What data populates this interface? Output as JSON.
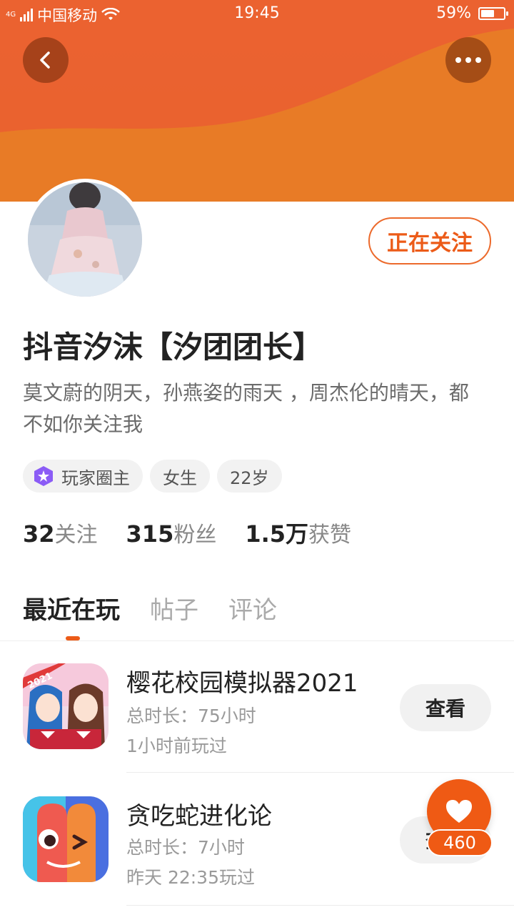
{
  "status_bar": {
    "network": "4G",
    "carrier": "中国移动",
    "time": "19:45",
    "battery_percent": "59%",
    "battery_level": 0.59
  },
  "header": {
    "back_icon": "chevron-left-icon",
    "more_icon": "more-dots-icon",
    "banner_color": "#ec6a2c"
  },
  "profile": {
    "follow_label": "正在关注",
    "username": "抖音汐沫【汐团团长】",
    "bio": "莫文蔚的阴天，孙燕姿的雨天 ，周杰伦的晴天，都不如你关注我",
    "tags": {
      "leader": "玩家圈主",
      "gender": "女生",
      "age": "22岁"
    },
    "stats": {
      "following_count": "32",
      "following_label": "关注",
      "fans_count": "315",
      "fans_label": "粉丝",
      "likes_count": "1.5万",
      "likes_label": "获赞"
    }
  },
  "tabs": {
    "recent": "最近在玩",
    "posts": "帖子",
    "comments": "评论"
  },
  "games": [
    {
      "title": "樱花校园模拟器2021",
      "duration": "总时长：75小时",
      "last_played": "1小时前玩过",
      "button": "查看",
      "badge": "2021"
    },
    {
      "title": "贪吃蛇进化论",
      "duration": "总时长：7小时",
      "last_played": "昨天 22:35玩过",
      "button": "查看"
    }
  ],
  "like_fab": {
    "count": "460",
    "icon": "heart-icon"
  },
  "accent_color": "#ec5b18"
}
